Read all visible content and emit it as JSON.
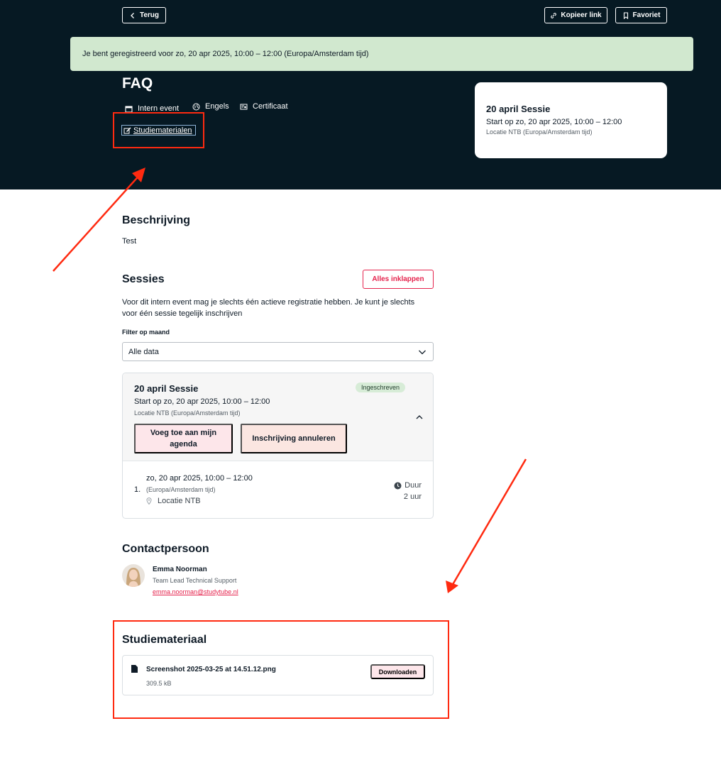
{
  "header": {
    "back_label": "Terug",
    "copy_link_label": "Kopieer link",
    "favorite_label": "Favoriet"
  },
  "banner": {
    "text": "Je bent geregistreerd voor zo, 20 apr 2025, 10:00 – 12:00 (Europa/Amsterdam tijd)"
  },
  "event": {
    "title": "FAQ",
    "meta": [
      {
        "icon": "calendar-icon",
        "label": "Intern event"
      },
      {
        "icon": "globe-icon",
        "label": "Engels"
      },
      {
        "icon": "certificate-icon",
        "label": "Certificaat"
      }
    ],
    "study_materials_link": "Studiematerialen"
  },
  "session_card": {
    "title": "20 april Sessie",
    "start": "Start op zo, 20 apr 2025, 10:00 – 12:00",
    "location": "Locatie NTB (Europa/Amsterdam tijd)"
  },
  "description": {
    "heading": "Beschrijving",
    "text": "Test"
  },
  "sessions": {
    "heading": "Sessies",
    "collapse_label": "Alles inklappen",
    "info_line1": "Voor dit intern event mag je slechts één actieve registratie hebben. Je kunt je slechts",
    "info_line2": "voor één sessie tegelijk inschrijven",
    "filter_label": "Filter op maand",
    "filter_value": "Alle data",
    "items": [
      {
        "title": "20 april Sessie",
        "badge": "Ingeschreven",
        "start": "Start op zo, 20 apr 2025, 10:00 – 12:00",
        "location": "Locatie NTB (Europa/Amsterdam tijd)",
        "add_agenda_line1": "Voeg toe aan mijn",
        "add_agenda_line2": "agenda",
        "cancel_label": "Inschrijving annuleren",
        "occurrence": {
          "number": "1.",
          "date": "zo, 20 apr 2025, 10:00 – 12:00",
          "timezone": "(Europa/Amsterdam tijd)",
          "location": "Locatie NTB",
          "duration_label": "Duur",
          "duration_value": "2 uur"
        }
      }
    ]
  },
  "contact": {
    "heading": "Contactpersoon",
    "name": "Emma Noorman",
    "role": "Team Lead Technical Support",
    "email": "emma.noorman@studytube.nl"
  },
  "study_material": {
    "heading": "Studiemateriaal",
    "files": [
      {
        "name": "Screenshot 2025-03-25 at 14.51.12.png",
        "size": "309.5 kB",
        "download_label": "Downloaden"
      }
    ]
  },
  "colors": {
    "hero_bg": "#061923",
    "banner_bg": "#d1e8cf",
    "accent": "#e5224c",
    "annotation": "#ff2a10"
  }
}
